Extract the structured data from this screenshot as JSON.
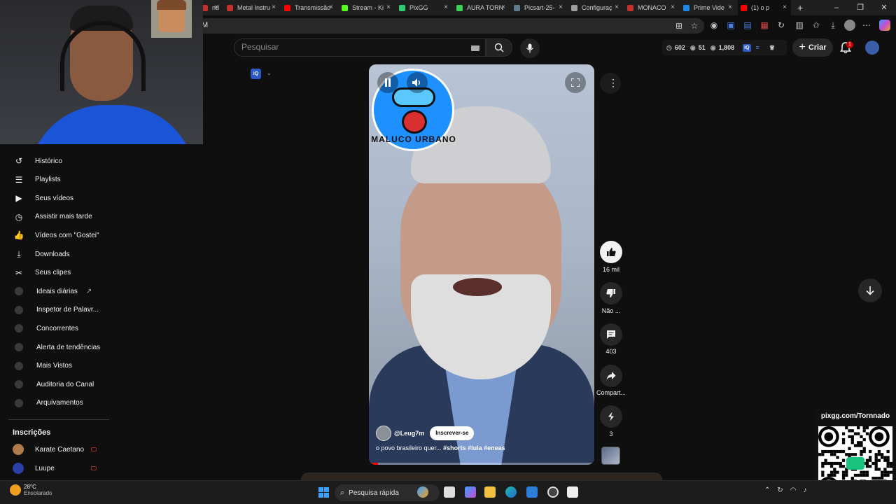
{
  "browser": {
    "tabs": [
      {
        "title": "nd",
        "favicon_color": "#c4302b",
        "active": false
      },
      {
        "title": "Metal Instru",
        "favicon_color": "#c4302b",
        "active": false
      },
      {
        "title": "Transmissão",
        "favicon_color": "#ff0000",
        "active": false
      },
      {
        "title": "Stream - Ki",
        "favicon_color": "#53fc18",
        "active": false
      },
      {
        "title": "PixGG",
        "favicon_color": "#2ecc71",
        "active": false
      },
      {
        "title": "AURA TORN",
        "favicon_color": "#39d353",
        "active": false
      },
      {
        "title": "Picsart-25-",
        "favicon_color": "#607d8b",
        "active": false
      },
      {
        "title": "Configuraç",
        "favicon_color": "#9e9e9e",
        "active": false
      },
      {
        "title": "MONACO",
        "favicon_color": "#c4302b",
        "active": false
      },
      {
        "title": "Prime Vide",
        "favicon_color": "#1e88e5",
        "active": false
      },
      {
        "title": "(1) o p",
        "favicon_color": "#ff0000",
        "active": true
      }
    ],
    "new_tab": "+",
    "address_text": "M",
    "controls": {
      "minimize": "–",
      "restore": "❐",
      "close": "✕"
    }
  },
  "header": {
    "search_placeholder": "Pesquisar",
    "stats": {
      "views": "602",
      "likes": "51",
      "subs": "1,808",
      "badge": "iQ"
    },
    "create_label": "Criar",
    "notifications_count": "1"
  },
  "sidebar": {
    "items": [
      {
        "label": "Histórico",
        "icon": "history-icon"
      },
      {
        "label": "Playlists",
        "icon": "playlist-icon"
      },
      {
        "label": "Seus vídeos",
        "icon": "video-icon"
      },
      {
        "label": "Assistir mais tarde",
        "icon": "clock-icon"
      },
      {
        "label": "Vídeos com \"Gostei\"",
        "icon": "thumbs-up-icon"
      },
      {
        "label": "Downloads",
        "icon": "download-icon"
      },
      {
        "label": "Seus clipes",
        "icon": "scissors-icon"
      },
      {
        "label": "Ideais diárias",
        "icon": "vidiq-icon"
      },
      {
        "label": "Inspetor de Palavr...",
        "icon": "vidiq-icon"
      },
      {
        "label": "Concorrentes",
        "icon": "vidiq-icon"
      },
      {
        "label": "Alerta de tendências",
        "icon": "vidiq-icon"
      },
      {
        "label": "Mais Vistos",
        "icon": "vidiq-icon"
      },
      {
        "label": "Auditoria do Canal",
        "icon": "vidiq-icon"
      },
      {
        "label": "Arquivamentos",
        "icon": "vidiq-icon"
      }
    ],
    "subscriptions_title": "Inscrições",
    "subscriptions": [
      {
        "name": "Karate Caetano",
        "avatar_color": "#b07a4a"
      },
      {
        "name": "Luupe",
        "avatar_color": "#2b3fa8"
      }
    ]
  },
  "short": {
    "channel": "@Leug7m",
    "subscribe_label": "Inscrever-se",
    "title": "o povo brasileiro quer...",
    "hashtags": "#shorts #lula #eneas",
    "progress": 0.04,
    "logo_text": "MALUCO URBANO"
  },
  "actions": {
    "likes": "16 mil",
    "dislike": "Não ...",
    "comments": "403",
    "share": "Compart...",
    "remix": "3"
  },
  "overlay": {
    "qr_url": "pixgg.com/Tornnado"
  },
  "taskbar": {
    "temperature": "28°C",
    "weather": "Ensolarado",
    "search": "Pesquisa rápida"
  }
}
